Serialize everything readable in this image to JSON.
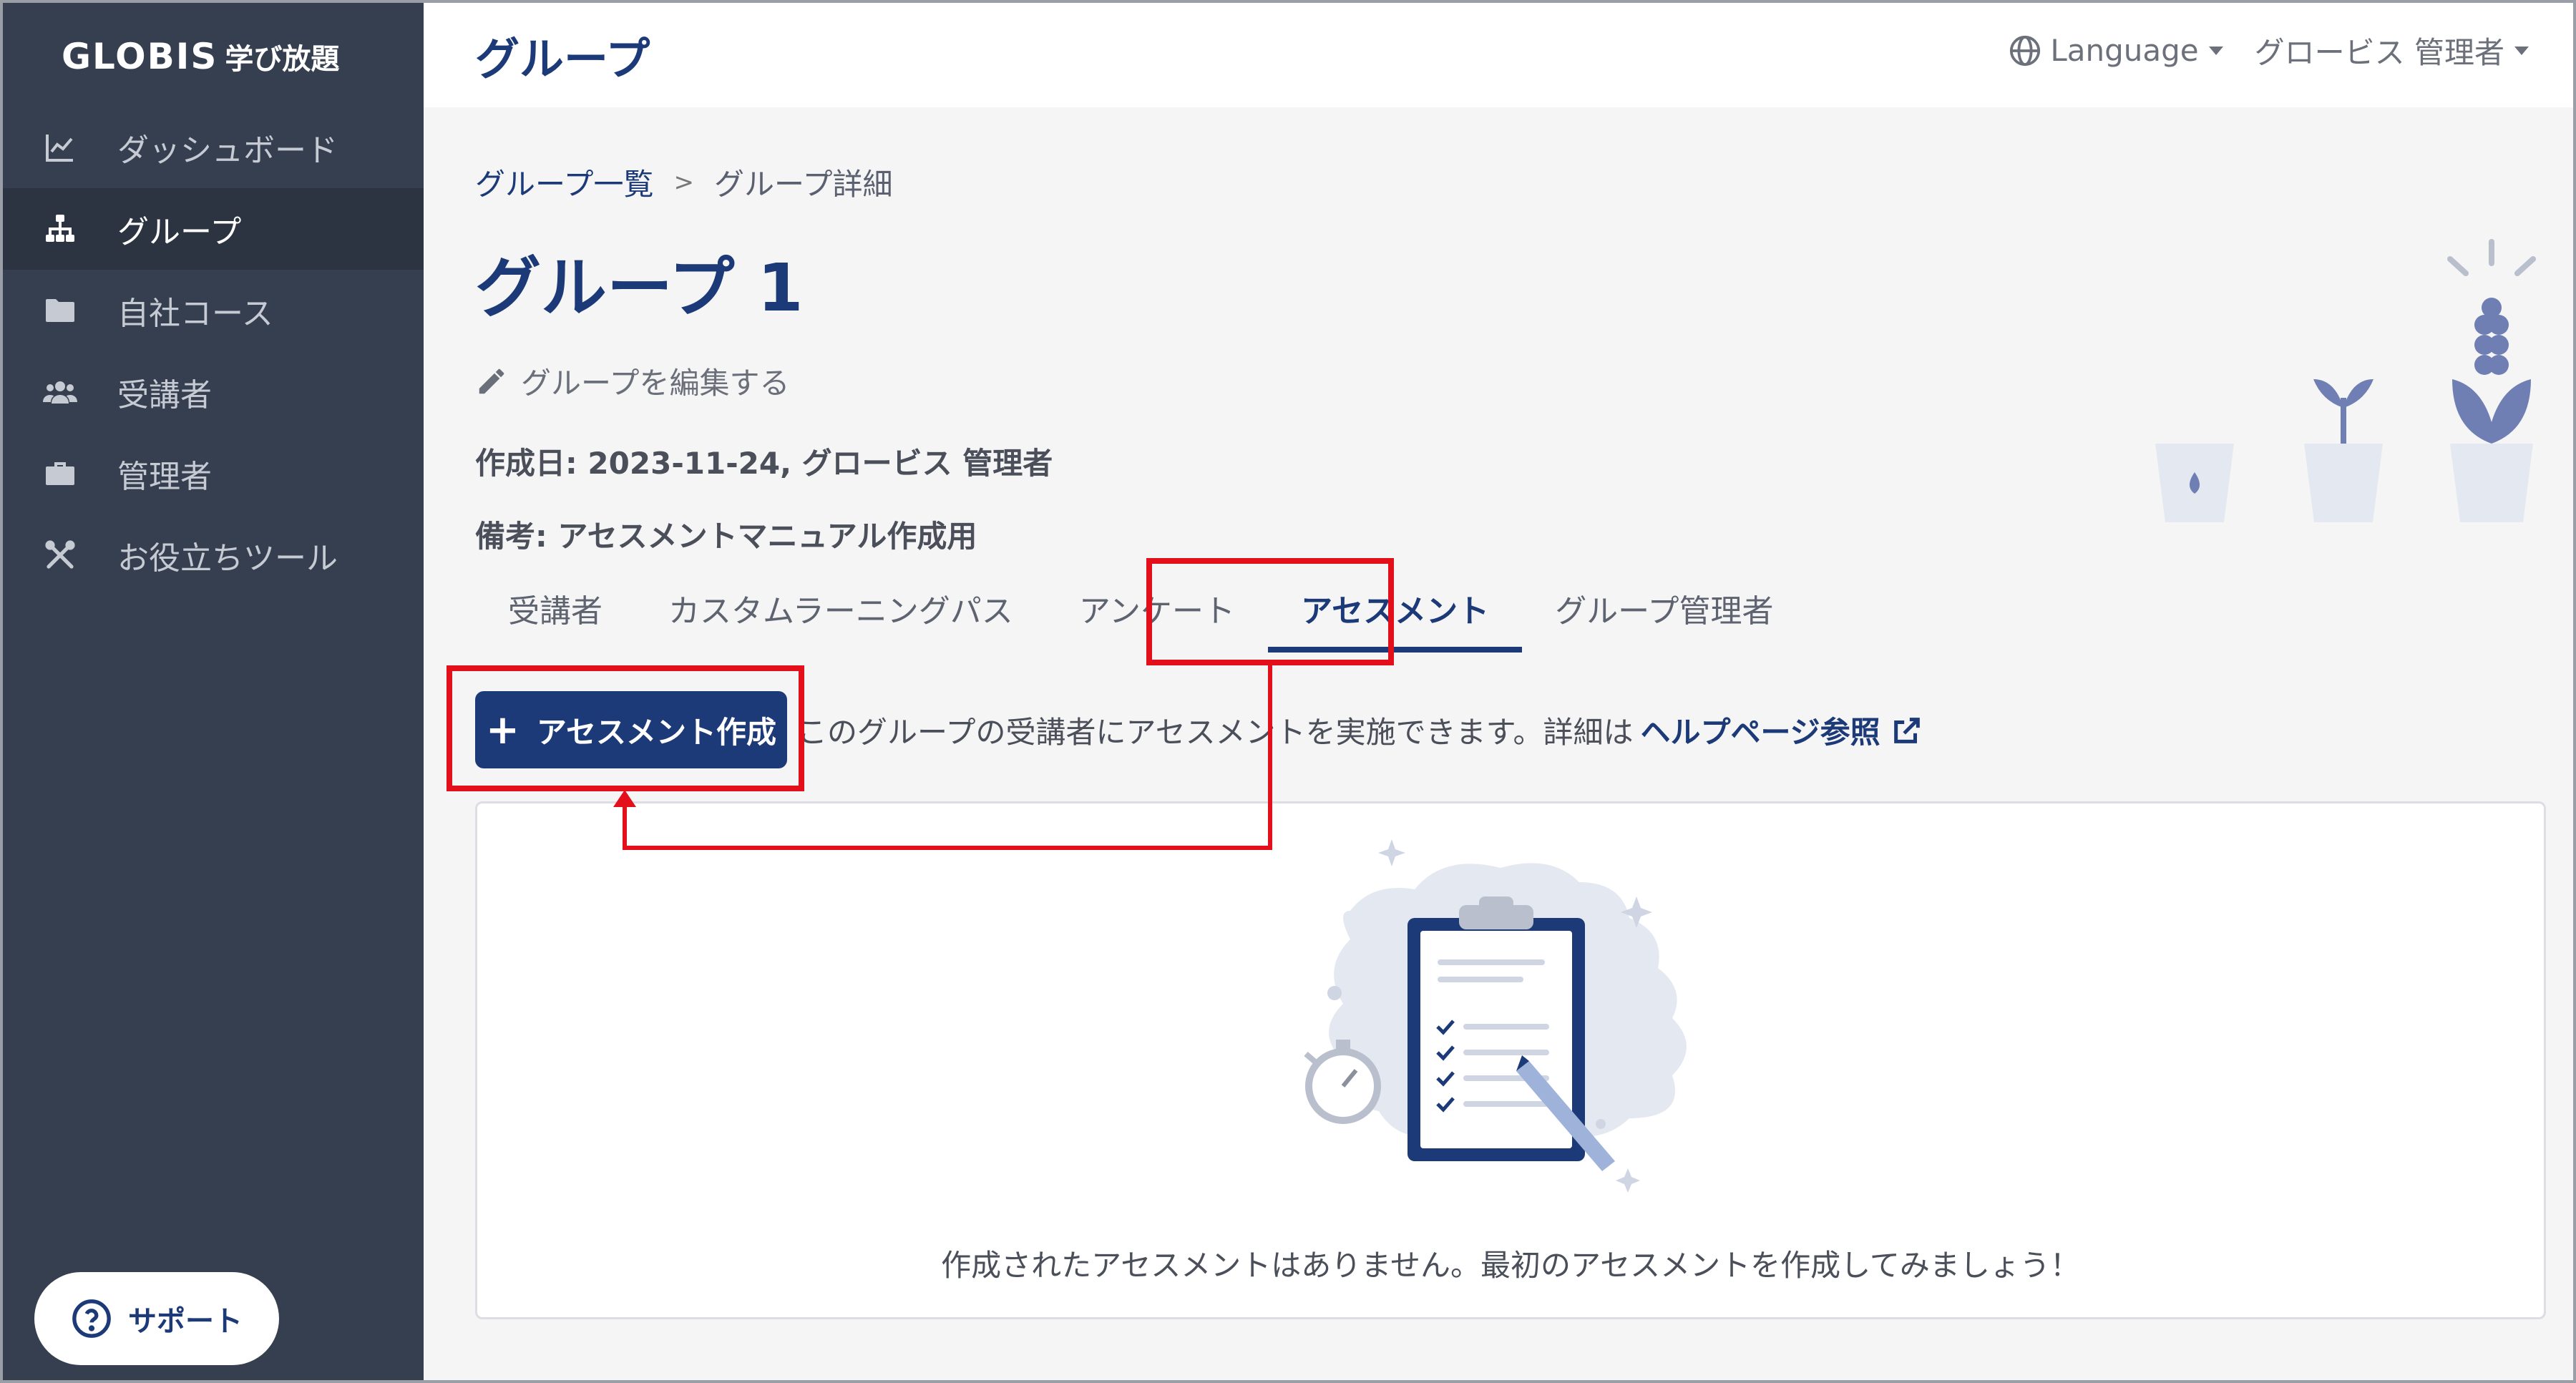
{
  "brand": {
    "name": "GLOBIS",
    "sub": "学び放題"
  },
  "sidebar": {
    "items": [
      {
        "label": "ダッシュボード",
        "icon": "chart-line-icon",
        "active": false
      },
      {
        "label": "グループ",
        "icon": "sitemap-icon",
        "active": true
      },
      {
        "label": "自社コース",
        "icon": "folder-icon",
        "active": false
      },
      {
        "label": "受講者",
        "icon": "users-icon",
        "active": false
      },
      {
        "label": "管理者",
        "icon": "briefcase-icon",
        "active": false
      },
      {
        "label": "お役立ちツール",
        "icon": "tools-icon",
        "active": false
      }
    ],
    "support_label": "サポート"
  },
  "header": {
    "title": "グループ",
    "language_label": "Language",
    "user_label": "グロービス 管理者"
  },
  "main": {
    "breadcrumb": {
      "parent": "グループ一覧",
      "separator": ">",
      "current": "グループ詳細"
    },
    "group_title": "グループ 1",
    "edit_label": "グループを編集する",
    "created": "作成日: 2023-11-24, グロービス 管理者",
    "note": "備考: アセスメントマニュアル作成用",
    "tabs": [
      {
        "label": "受講者",
        "active": false
      },
      {
        "label": "カスタムラーニングパス",
        "active": false
      },
      {
        "label": "アンケート",
        "active": false
      },
      {
        "label": "アセスメント",
        "active": true
      },
      {
        "label": "グループ管理者",
        "active": false
      }
    ],
    "create_button": {
      "plus": "+",
      "label": "アセスメント作成"
    },
    "info_text": "このグループの受講者にアセスメントを実施できます。詳細は",
    "help_link": "ヘルプページ参照",
    "empty_message": "作成されたアセスメントはありません。最初のアセスメントを作成してみましょう！"
  },
  "colors": {
    "sidebar_bg": "#363f50",
    "primary": "#1d3a78",
    "annotation": "#e3101b",
    "main_bg": "#f5f5f6"
  }
}
